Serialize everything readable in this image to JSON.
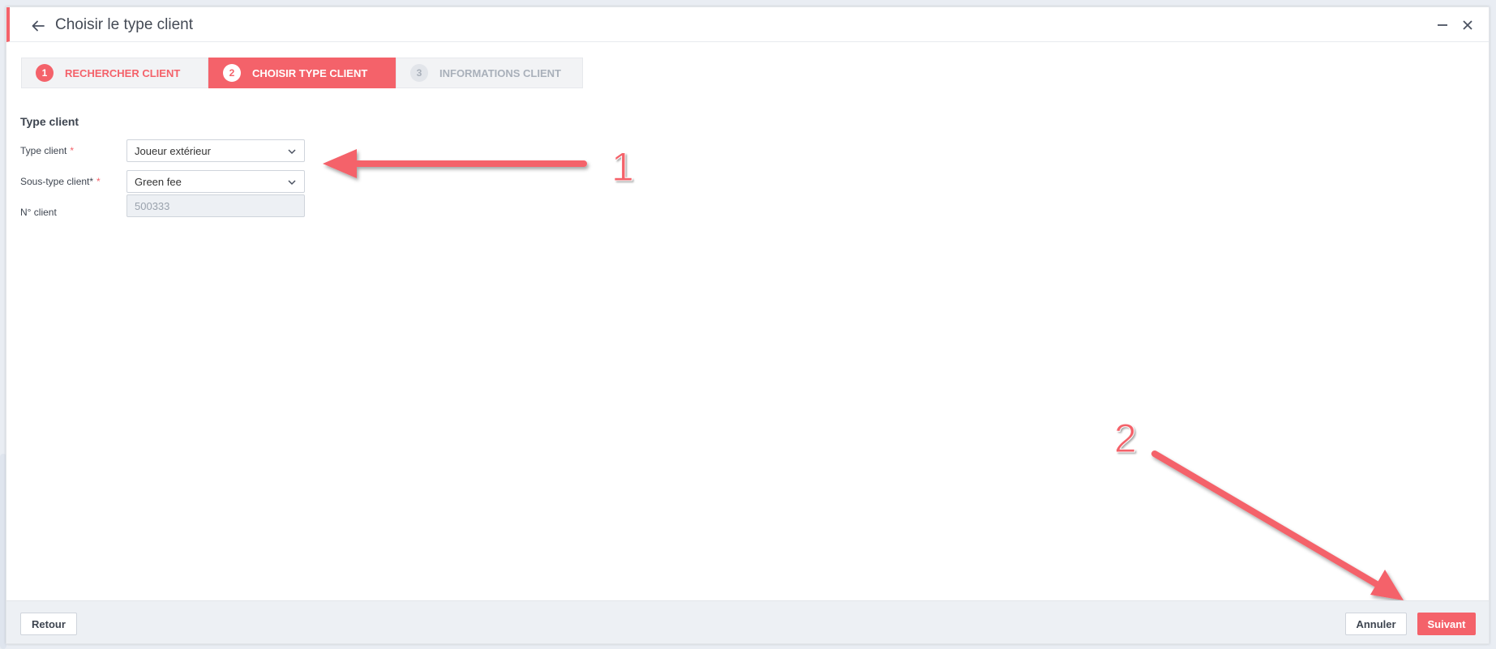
{
  "window": {
    "title": "Choisir le type client",
    "back_icon": "arrow-left-icon",
    "minimize_icon": "minimize-icon",
    "close_icon": "close-icon"
  },
  "stepper": {
    "steps": [
      {
        "number": "1",
        "label": "RECHERCHER CLIENT",
        "state": "done"
      },
      {
        "number": "2",
        "label": "CHOISIR TYPE CLIENT",
        "state": "active"
      },
      {
        "number": "3",
        "label": "INFORMATIONS CLIENT",
        "state": "todo"
      }
    ]
  },
  "form": {
    "section_title": "Type client",
    "type_client": {
      "label": "Type client",
      "required_mark": "*",
      "value": "Joueur extérieur"
    },
    "sous_type": {
      "label": "Sous-type client*",
      "required_mark": "*",
      "value": "Green fee"
    },
    "numero": {
      "label": "N° client",
      "value": "500333"
    }
  },
  "annotations": {
    "one": "1",
    "two": "2"
  },
  "footer": {
    "back_label": "Retour",
    "cancel_label": "Annuler",
    "next_label": "Suivant"
  },
  "colors": {
    "accent": "#f4626a",
    "footer_bg": "#edf0f4"
  }
}
